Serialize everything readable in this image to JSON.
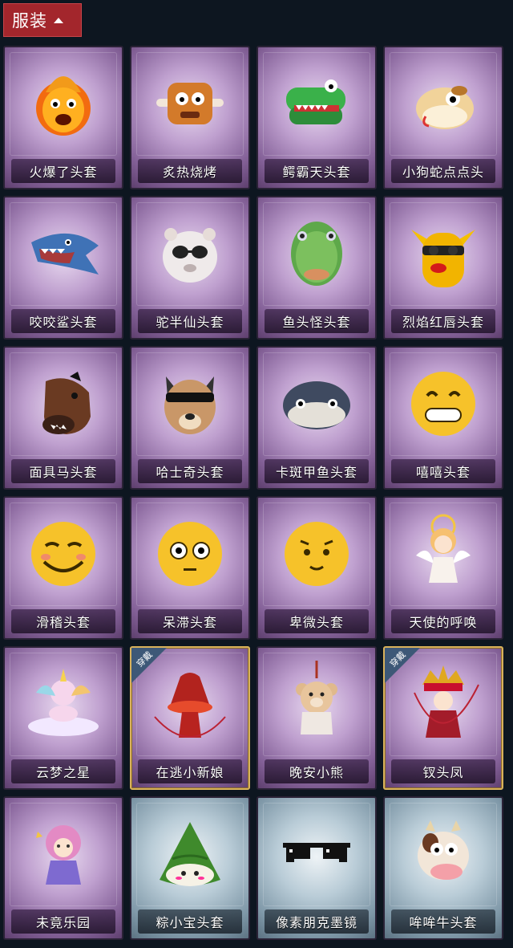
{
  "header": {
    "title": "服装"
  },
  "badge_text": "穿戴",
  "items": [
    {
      "label": "火爆了头套",
      "icon": "fire-mascot-icon",
      "bg": "purple"
    },
    {
      "label": "炙热烧烤",
      "icon": "bbq-meat-icon",
      "bg": "purple"
    },
    {
      "label": "鳄霸天头套",
      "icon": "crocodile-icon",
      "bg": "purple"
    },
    {
      "label": "小狗蛇点点头",
      "icon": "snake-dog-icon",
      "bg": "purple"
    },
    {
      "label": "咬咬鲨头套",
      "icon": "shark-icon",
      "bg": "purple"
    },
    {
      "label": "驼半仙头套",
      "icon": "alpaca-icon",
      "bg": "purple"
    },
    {
      "label": "鱼头怪头套",
      "icon": "fish-head-icon",
      "bg": "purple"
    },
    {
      "label": "烈焰红唇头套",
      "icon": "yellow-mouse-lips-icon",
      "bg": "purple"
    },
    {
      "label": "面具马头套",
      "icon": "horse-head-icon",
      "bg": "purple"
    },
    {
      "label": "哈士奇头套",
      "icon": "husky-icon",
      "bg": "purple"
    },
    {
      "label": "卡斑甲鱼头套",
      "icon": "turtle-icon",
      "bg": "purple"
    },
    {
      "label": "嘻嘻头套",
      "icon": "grin-emoji-icon",
      "bg": "purple"
    },
    {
      "label": "滑稽头套",
      "icon": "funny-emoji-icon",
      "bg": "purple"
    },
    {
      "label": "呆滞头套",
      "icon": "dazed-emoji-icon",
      "bg": "purple"
    },
    {
      "label": "卑微头套",
      "icon": "humble-emoji-icon",
      "bg": "purple"
    },
    {
      "label": "天使的呼唤",
      "icon": "angel-doll-icon",
      "bg": "purple"
    },
    {
      "label": "云梦之星",
      "icon": "unicorn-cloud-icon",
      "bg": "purple"
    },
    {
      "label": "在逃小新娘",
      "icon": "red-bride-icon",
      "bg": "purple",
      "equipped": true
    },
    {
      "label": "晚安小熊",
      "icon": "teddy-bear-icon",
      "bg": "purple"
    },
    {
      "label": "钗头凤",
      "icon": "phoenix-crown-icon",
      "bg": "purple",
      "equipped": true
    },
    {
      "label": "未竟乐园",
      "icon": "fairy-girl-icon",
      "bg": "purple"
    },
    {
      "label": "粽小宝头套",
      "icon": "rice-dumpling-icon",
      "bg": "blue"
    },
    {
      "label": "像素朋克墨镜",
      "icon": "pixel-sunglasses-icon",
      "bg": "blue"
    },
    {
      "label": "哞哞牛头套",
      "icon": "cow-head-icon",
      "bg": "blue"
    }
  ]
}
